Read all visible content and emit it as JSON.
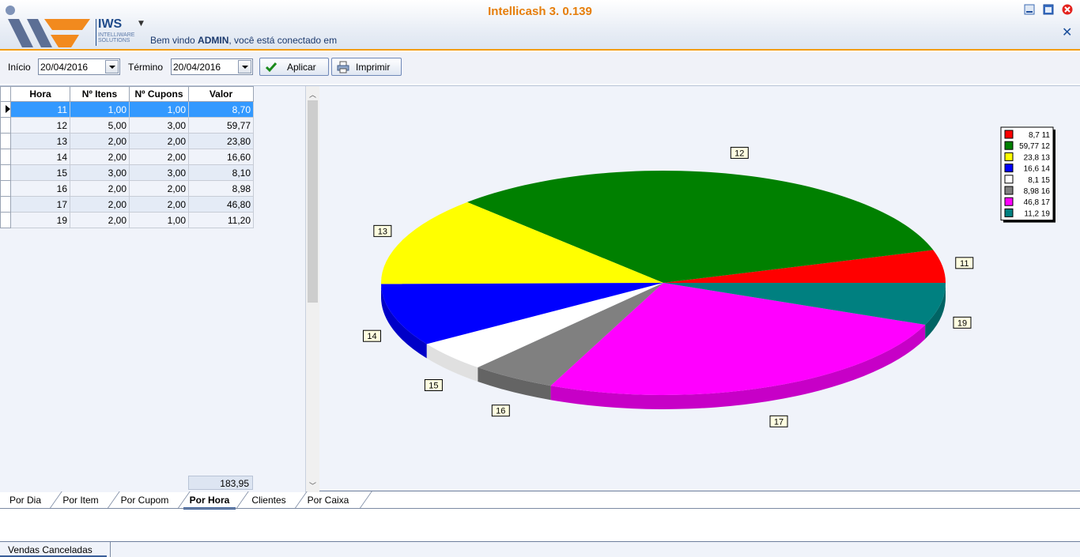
{
  "app": {
    "title": "Intellicash 3. 0.139",
    "logo_text": "IWS",
    "logo_sub": "INTELLIWARE SOLUTIONS",
    "welcome_prefix": "Bem vindo ",
    "welcome_user": "ADMIN",
    "welcome_suffix": ", você está conectado em"
  },
  "toolbar": {
    "inicio_label": "Início",
    "inicio_value": "20/04/2016",
    "termino_label": "Término",
    "termino_value": "20/04/2016",
    "aplicar_label": "Aplicar",
    "imprimir_label": "Imprimir"
  },
  "grid": {
    "headers": [
      "Hora",
      "Nº Itens",
      "Nº Cupons",
      "Valor"
    ],
    "rows": [
      [
        "11",
        "1,00",
        "1,00",
        "8,70"
      ],
      [
        "12",
        "5,00",
        "3,00",
        "59,77"
      ],
      [
        "13",
        "2,00",
        "2,00",
        "23,80"
      ],
      [
        "14",
        "2,00",
        "2,00",
        "16,60"
      ],
      [
        "15",
        "3,00",
        "3,00",
        "8,10"
      ],
      [
        "16",
        "2,00",
        "2,00",
        "8,98"
      ],
      [
        "17",
        "2,00",
        "2,00",
        "46,80"
      ],
      [
        "19",
        "2,00",
        "1,00",
        "11,20"
      ]
    ],
    "total": "183,95"
  },
  "chart_data": {
    "type": "pie",
    "categories": [
      "11",
      "12",
      "13",
      "14",
      "15",
      "16",
      "17",
      "19"
    ],
    "values": [
      8.7,
      59.77,
      23.8,
      16.6,
      8.1,
      8.98,
      46.8,
      11.2
    ],
    "colors": [
      "#ff0000",
      "#008000",
      "#ffff00",
      "#0000ff",
      "#ffffff",
      "#808080",
      "#ff00ff",
      "#008080"
    ],
    "legend": [
      "8,7 11",
      "59,77 12",
      "23,8 13",
      "16,6 14",
      "8,1 15",
      "8,98 16",
      "46,8 17",
      "11,2 19"
    ],
    "legend_position": "top-right",
    "style": "3d"
  },
  "tabs": [
    "Por Dia",
    "Por Item",
    "Por Cupom",
    "Por Hora",
    "Clientes",
    "Por Caixa"
  ],
  "active_tab": "Por Hora",
  "bottom_tab": "Vendas Canceladas"
}
